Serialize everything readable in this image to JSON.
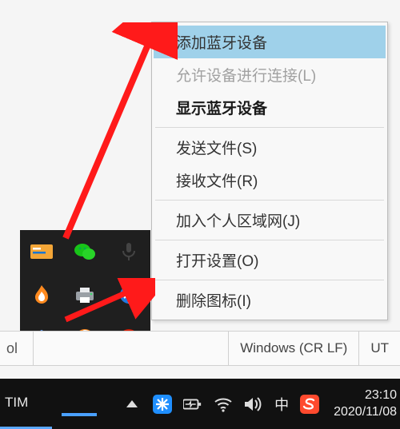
{
  "context_menu": {
    "items": [
      {
        "label": "添加蓝牙设备",
        "state": "highlighted"
      },
      {
        "label": "允许设备进行连接(L)",
        "state": "disabled"
      },
      {
        "label": "显示蓝牙设备",
        "state": "bold"
      },
      {
        "sep": true
      },
      {
        "label": "发送文件(S)",
        "state": "normal"
      },
      {
        "label": "接收文件(R)",
        "state": "normal"
      },
      {
        "sep": true
      },
      {
        "label": "加入个人区域网(J)",
        "state": "normal"
      },
      {
        "sep": true
      },
      {
        "label": "打开设置(O)",
        "state": "normal"
      },
      {
        "sep": true
      },
      {
        "label": "删除图标(I)",
        "state": "normal"
      }
    ]
  },
  "tray": {
    "icons": [
      "credentials-icon",
      "wechat-icon",
      "microphone-icon",
      "flame-icon",
      "printer-icon",
      "bluetooth-icon",
      "cube-icon",
      "browser-icon",
      "netease-icon"
    ]
  },
  "status_bar": {
    "left": "ol",
    "eol": "Windows  (CR LF)",
    "enc": "UT"
  },
  "taskbar": {
    "app": "TIM",
    "ime": "中",
    "clock_time": "23:10",
    "clock_date": "2020/11/08"
  }
}
